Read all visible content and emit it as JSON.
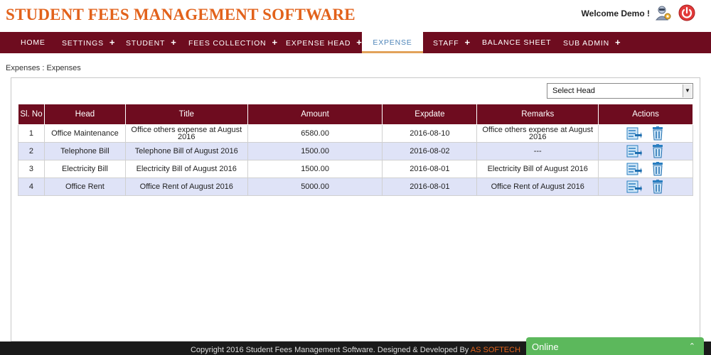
{
  "header": {
    "app_title": "STUDENT FEES MANAGEMENT SOFTWARE",
    "welcome_text": "Welcome Demo !"
  },
  "nav": {
    "items": [
      {
        "label": "HOME",
        "has_submenu": false
      },
      {
        "label": "SETTINGS",
        "has_submenu": true
      },
      {
        "label": "STUDENT",
        "has_submenu": true
      },
      {
        "label": "FEES COLLECTION",
        "has_submenu": true
      },
      {
        "label": "EXPENSE HEAD",
        "has_submenu": true
      },
      {
        "label": "EXPENSE",
        "has_submenu": false,
        "active": true
      },
      {
        "label": "STAFF",
        "has_submenu": true
      },
      {
        "label": "BALANCE SHEET",
        "has_submenu": false
      },
      {
        "label": "SUB ADMIN",
        "has_submenu": true
      }
    ],
    "submenu_glyph": "+"
  },
  "breadcrumb": "Expenses : Expenses",
  "filter": {
    "selected": "Select Head"
  },
  "table": {
    "columns": [
      "Sl. No",
      "Head",
      "Title",
      "Amount",
      "Expdate",
      "Remarks",
      "Actions"
    ],
    "rows": [
      {
        "sl": "1",
        "head": "Office Maintenance",
        "title": "Office others expense at August 2016",
        "amount": "6580.00",
        "expdate": "2016-08-10",
        "remarks": "Office others expense at August 2016"
      },
      {
        "sl": "2",
        "head": "Telephone Bill",
        "title": "Telephone Bill of August 2016",
        "amount": "1500.00",
        "expdate": "2016-08-02",
        "remarks": "---"
      },
      {
        "sl": "3",
        "head": "Electricity Bill",
        "title": "Electricity Bill of August 2016",
        "amount": "1500.00",
        "expdate": "2016-08-01",
        "remarks": "Electricity Bill of August 2016"
      },
      {
        "sl": "4",
        "head": "Office Rent",
        "title": "Office Rent of August 2016",
        "amount": "5000.00",
        "expdate": "2016-08-01",
        "remarks": "Office Rent of August 2016"
      }
    ],
    "action_icons": [
      "edit-icon",
      "delete-icon"
    ]
  },
  "footer": {
    "copyright": "Copyright 2016 Student Fees Management Software. Designed & Developed By ",
    "brand": "AS SOFTECH"
  },
  "chat": {
    "label": "Online",
    "caret": "⌃"
  },
  "colors": {
    "brand_orange": "#e2621b",
    "nav_bg": "#6e0c1f",
    "active_tab_text": "#4d84b8",
    "active_tab_underline": "#e2a25a",
    "row_stripe": "#dfe3f7",
    "chat_green": "#5cb85c",
    "footer_bg": "#1a1a1a"
  }
}
